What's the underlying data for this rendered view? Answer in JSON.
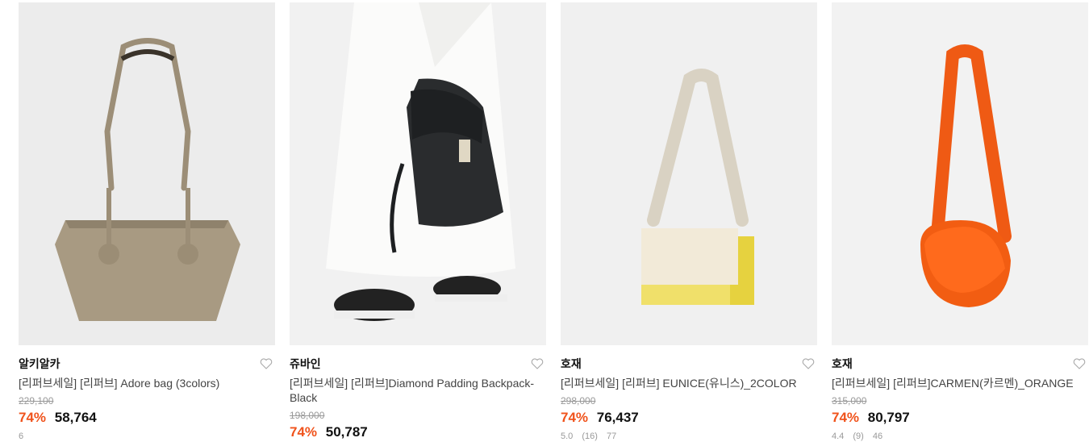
{
  "products": [
    {
      "brand": "알키알카",
      "title": "[리퍼브세일] [리퍼브] Adore bag (3colors)",
      "original_price": "229,100",
      "discount": "74%",
      "sale_price": "58,764",
      "rating": "",
      "reviews": "",
      "likes": "6",
      "image": "tote-bag-taupe"
    },
    {
      "brand": "쥬바인",
      "title": "[리퍼브세일] [리퍼브]Diamond Padding Backpack-Black",
      "original_price": "198,000",
      "discount": "74%",
      "sale_price": "50,787",
      "rating": "",
      "reviews": "",
      "likes": "",
      "image": "black-quilted-backpack"
    },
    {
      "brand": "호재",
      "title": "[리퍼브세일] [리퍼브] EUNICE(유니스)_2COLOR",
      "original_price": "298,000",
      "discount": "74%",
      "sale_price": "76,437",
      "rating": "5.0",
      "reviews": "(16)",
      "likes": "77",
      "image": "cream-yellow-shoulder-bag"
    },
    {
      "brand": "호재",
      "title": "[리퍼브세일] [리퍼브]CARMEN(카르멘)_ORANGE",
      "original_price": "315,000",
      "discount": "74%",
      "sale_price": "80,797",
      "rating": "4.4",
      "reviews": "(9)",
      "likes": "46",
      "image": "orange-saddle-bag"
    }
  ],
  "colors": {
    "discount": "#f0531c",
    "original_price": "#999999",
    "title": "#444444"
  }
}
